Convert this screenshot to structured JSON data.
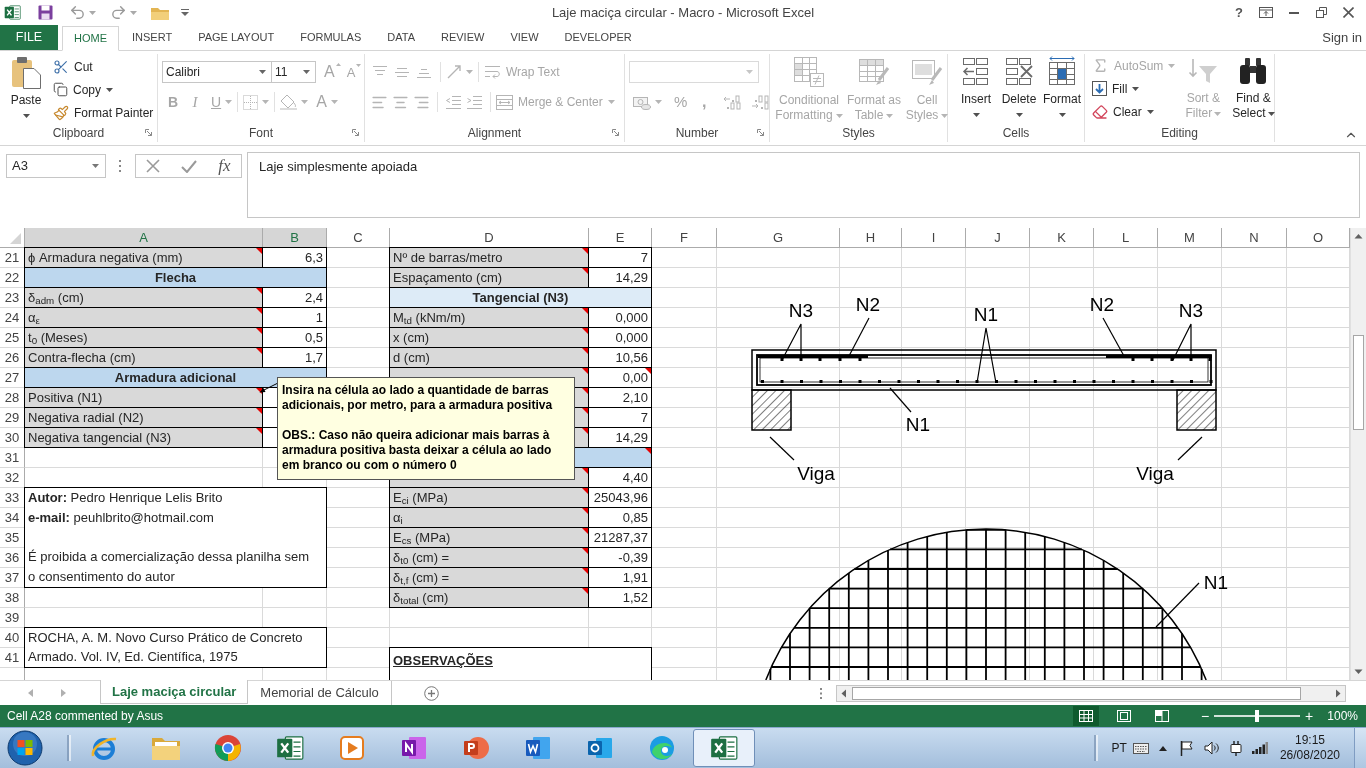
{
  "window": {
    "title": "Laje maciça circular - Macro - Microsoft Excel",
    "help": "?"
  },
  "ribbon_tabs": [
    {
      "label": "FILE",
      "kind": "file",
      "selected": false
    },
    {
      "label": "HOME",
      "kind": "tab",
      "selected": true
    },
    {
      "label": "INSERT",
      "kind": "tab",
      "selected": false
    },
    {
      "label": "PAGE LAYOUT",
      "kind": "tab",
      "selected": false
    },
    {
      "label": "FORMULAS",
      "kind": "tab",
      "selected": false
    },
    {
      "label": "DATA",
      "kind": "tab",
      "selected": false
    },
    {
      "label": "REVIEW",
      "kind": "tab",
      "selected": false
    },
    {
      "label": "VIEW",
      "kind": "tab",
      "selected": false
    },
    {
      "label": "DEVELOPER",
      "kind": "tab",
      "selected": false
    }
  ],
  "account": {
    "sign_in": "Sign in"
  },
  "ribbon": {
    "clipboard": {
      "title": "Clipboard",
      "paste": {
        "label": "Paste",
        "disabled": false
      },
      "buttons": [
        {
          "kind": "cut",
          "label": "Cut",
          "disabled": false
        },
        {
          "kind": "copy",
          "label": "Copy",
          "disabled": false
        },
        {
          "kind": "painter",
          "label": "Format Painter",
          "disabled": false
        }
      ]
    },
    "font": {
      "title": "Font",
      "font_name": "Calibri",
      "font_size": "11",
      "grow": {
        "label": "A",
        "disabled": true
      },
      "shrink": {
        "label": "A",
        "disabled": true
      },
      "styles": [
        {
          "kind": "bold",
          "label": "B",
          "disabled": true
        },
        {
          "kind": "italic",
          "label": "I",
          "disabled": true
        },
        {
          "kind": "underline",
          "label": "U",
          "disabled": true
        }
      ],
      "font_color": {
        "label": "A",
        "disabled": true
      }
    },
    "alignment": {
      "title": "Alignment",
      "wrap_text": {
        "label": "Wrap Text",
        "disabled": true
      },
      "merge": {
        "label": "Merge & Center",
        "disabled": true
      }
    },
    "number": {
      "title": "Number",
      "percent": {
        "label": "%",
        "disabled": true
      },
      "comma": {
        "label": ",",
        "disabled": true
      }
    },
    "styles": {
      "title": "Styles",
      "buttons": [
        {
          "kind": "conditional",
          "label": "Conditional Formatting",
          "disabled": true
        },
        {
          "kind": "table",
          "label": "Format as Table",
          "disabled": true
        },
        {
          "kind": "cell_styles",
          "label": "Cell Styles",
          "disabled": true
        }
      ]
    },
    "cells": {
      "title": "Cells",
      "buttons": [
        {
          "kind": "insert",
          "label": "Insert",
          "disabled": false
        },
        {
          "kind": "delete",
          "label": "Delete",
          "disabled": false
        },
        {
          "kind": "format",
          "label": "Format",
          "disabled": false
        }
      ]
    },
    "editing": {
      "title": "Editing",
      "small": [
        {
          "kind": "sum",
          "label": "AutoSum",
          "disabled": true
        },
        {
          "kind": "fill",
          "label": "Fill",
          "disabled": false
        },
        {
          "kind": "clear",
          "label": "Clear",
          "disabled": false
        }
      ],
      "large": [
        {
          "kind": "sort",
          "label": "Sort & Filter",
          "disabled": true
        },
        {
          "kind": "find",
          "label": "Find & Select",
          "disabled": false
        }
      ]
    }
  },
  "formula_bar": {
    "name_box": "A3",
    "insert_function": "fx",
    "formula": "Laje simplesmente apoiada"
  },
  "sheet": {
    "columns": [
      {
        "label": "A",
        "selected": true
      },
      {
        "label": "B",
        "selected": true
      },
      {
        "label": "C",
        "selected": false
      },
      {
        "label": "D",
        "selected": false
      },
      {
        "label": "E",
        "selected": false
      },
      {
        "label": "F",
        "selected": false
      },
      {
        "label": "G",
        "selected": false
      },
      {
        "label": "H",
        "selected": false
      },
      {
        "label": "I",
        "selected": false
      },
      {
        "label": "J",
        "selected": false
      },
      {
        "label": "K",
        "selected": false
      },
      {
        "label": "L",
        "selected": false
      },
      {
        "label": "M",
        "selected": false
      },
      {
        "label": "N",
        "selected": false
      },
      {
        "label": "O",
        "selected": false
      }
    ],
    "rows": [
      "21",
      "22",
      "23",
      "24",
      "25",
      "26",
      "27",
      "28",
      "29",
      "30",
      "31",
      "32",
      "33",
      "34",
      "35",
      "36",
      "37",
      "38",
      "39",
      "40",
      "41"
    ],
    "left_table": [
      {
        "kind": "field",
        "label": "ϕ Armadura negativa (mm)",
        "value": "6,3",
        "comment": true
      },
      {
        "kind": "heading",
        "label": "Flecha",
        "color": "#bdd7ee"
      },
      {
        "kind": "field",
        "label": "δ$_{adm}$ (cm)",
        "value": "2,4",
        "comment": true
      },
      {
        "kind": "field",
        "label": "α$_{ε}$",
        "value": "1",
        "comment": true
      },
      {
        "kind": "field",
        "label": "t$_{0}$ (Meses)",
        "value": "0,5",
        "comment": true
      },
      {
        "kind": "field",
        "label": "Contra-flecha (cm)",
        "value": "1,7",
        "comment": true
      },
      {
        "kind": "heading",
        "label": "Armadura adicional",
        "color": "#bdd7ee"
      },
      {
        "kind": "field",
        "label": "Positiva (N1)",
        "comment": true
      },
      {
        "kind": "field",
        "label": "Negativa radial (N2)",
        "comment": true
      },
      {
        "kind": "field",
        "label": "Negativa tangencial (N3)",
        "comment": true
      }
    ],
    "author_box": {
      "author": "**Autor:** Pedro Henrique Lelis Brito",
      "email": "**e-mail:** peuhlbrito@hotmail.com",
      "notice": [
        "É proibida a comercialização dessa planilha sem",
        "o consentimento do autor"
      ]
    },
    "reference": [
      "ROCHA, A. M. Novo Curso Prático de Concreto",
      "Armado. Vol. IV, Ed. Científica, 1975"
    ],
    "right_table": [
      {
        "kind": "field",
        "label": "Nº de barras/metro",
        "value": "7",
        "comment": true
      },
      {
        "kind": "field",
        "label": "Espaçamento (cm)",
        "value": "14,29",
        "comment": true
      },
      {
        "kind": "heading",
        "label": "Tangencial (N3)",
        "color": "#ddebf7"
      },
      {
        "kind": "field",
        "label": "M$_{td}$ (kNm/m)",
        "value": "0,000",
        "comment": true
      },
      {
        "kind": "field",
        "label": "x (cm)",
        "value": "0,000",
        "comment": true
      },
      {
        "kind": "field",
        "label": "d (cm)",
        "value": "10,56",
        "comment": true
      },
      {
        "kind": "field",
        "value": "0,00",
        "comment": true,
        "value_comment": true
      },
      {
        "kind": "field",
        "value": "2,10",
        "comment": true
      },
      {
        "kind": "field",
        "value": "7",
        "comment": true
      },
      {
        "kind": "field",
        "value": "14,29",
        "comment": true
      },
      {
        "kind": "heading",
        "color": "#bdd7ee",
        "comment": true
      },
      {
        "kind": "field",
        "value": "4,40",
        "comment": true
      },
      {
        "kind": "field",
        "label": "E$_{ci}$ (MPa)",
        "value": "25043,96",
        "comment": true
      },
      {
        "kind": "field",
        "label": "α$_{i}$",
        "value": "0,85",
        "comment": true
      },
      {
        "kind": "field",
        "label": "E$_{cs}$ (MPa)",
        "value": "21287,37",
        "comment": true
      },
      {
        "kind": "field",
        "label": "δ$_{t0}$ (cm) =",
        "value": "-0,39",
        "comment": true
      },
      {
        "kind": "field",
        "label": "δ$_{t,f}$ (cm) =",
        "value": "1,91",
        "comment": true
      },
      {
        "kind": "field",
        "label": "δ$_{total}$ (cm)",
        "value": "1,52",
        "comment": true
      }
    ],
    "observations": {
      "title": "OBSERVAÇÕES"
    }
  },
  "comment": {
    "paragraphs": [
      [
        "Insira na célula ao lado a quantidade de barras",
        "adicionais, por metro, para a armadura positiva"
      ],
      [
        "OBS.: Caso não queira adicionar mais barras à",
        "armadura positiva basta deixar a célula ao lado",
        "em branco ou com o número 0"
      ]
    ]
  },
  "figure": {
    "labels": [
      "N3",
      "N2",
      "N1",
      "N2",
      "N3",
      "N1",
      "Viga",
      "Viga",
      "N1"
    ]
  },
  "sheet_tabs": [
    {
      "label": "Laje maciça circular",
      "selected": true
    },
    {
      "label": "Memorial de Cálculo",
      "selected": false
    }
  ],
  "status_bar": {
    "message": "Cell A28 commented by Asus",
    "views": [
      {
        "kind": "normal",
        "selected": true
      },
      {
        "kind": "page_layout",
        "selected": false
      },
      {
        "kind": "page_break",
        "selected": false
      }
    ],
    "zoom": {
      "minus": "−",
      "plus": "+",
      "level": 0.5,
      "reading": "100%"
    }
  },
  "taskbar": {
    "apps": [
      {
        "kind": "ie",
        "active": false
      },
      {
        "kind": "folder",
        "active": false
      },
      {
        "kind": "chrome",
        "active": false
      },
      {
        "kind": "excel",
        "active": false
      },
      {
        "kind": "media",
        "active": false
      },
      {
        "kind": "onenote",
        "active": false
      },
      {
        "kind": "powerpoint",
        "active": false
      },
      {
        "kind": "word",
        "active": false
      },
      {
        "kind": "outlook",
        "active": false
      },
      {
        "kind": "edge",
        "active": false
      },
      {
        "kind": "excel",
        "active": true
      }
    ],
    "language": "PT",
    "time": "19:15",
    "date": "26/08/2020"
  }
}
